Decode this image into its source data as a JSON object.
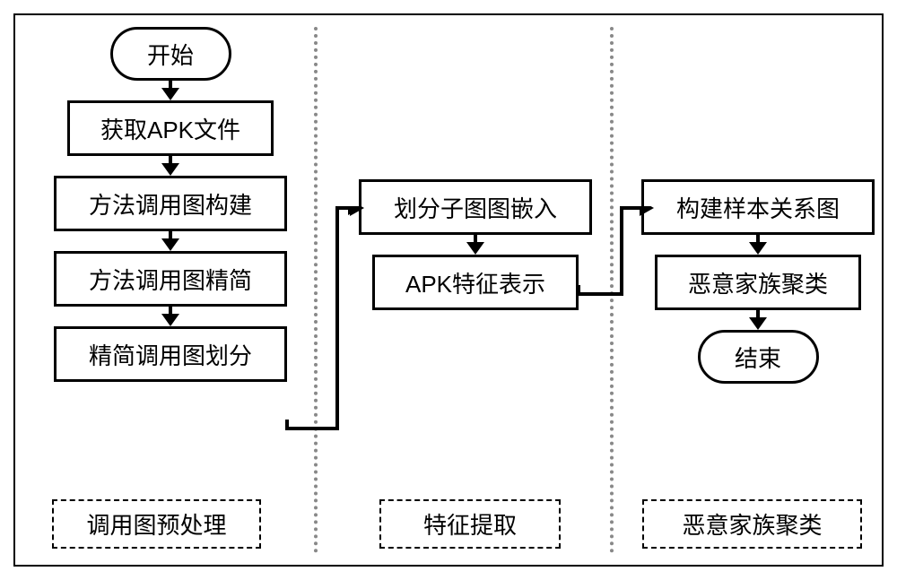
{
  "flow": {
    "start": "开始",
    "col1": {
      "step1": "获取APK文件",
      "step2": "方法调用图构建",
      "step3": "方法调用图精简",
      "step4": "精简调用图划分"
    },
    "col2": {
      "step1": "划分子图图嵌入",
      "step2": "APK特征表示"
    },
    "col3": {
      "step1": "构建样本关系图",
      "step2": "恶意家族聚类"
    },
    "end": "结束"
  },
  "sections": {
    "s1": "调用图预处理",
    "s2": "特征提取",
    "s3": "恶意家族聚类"
  }
}
